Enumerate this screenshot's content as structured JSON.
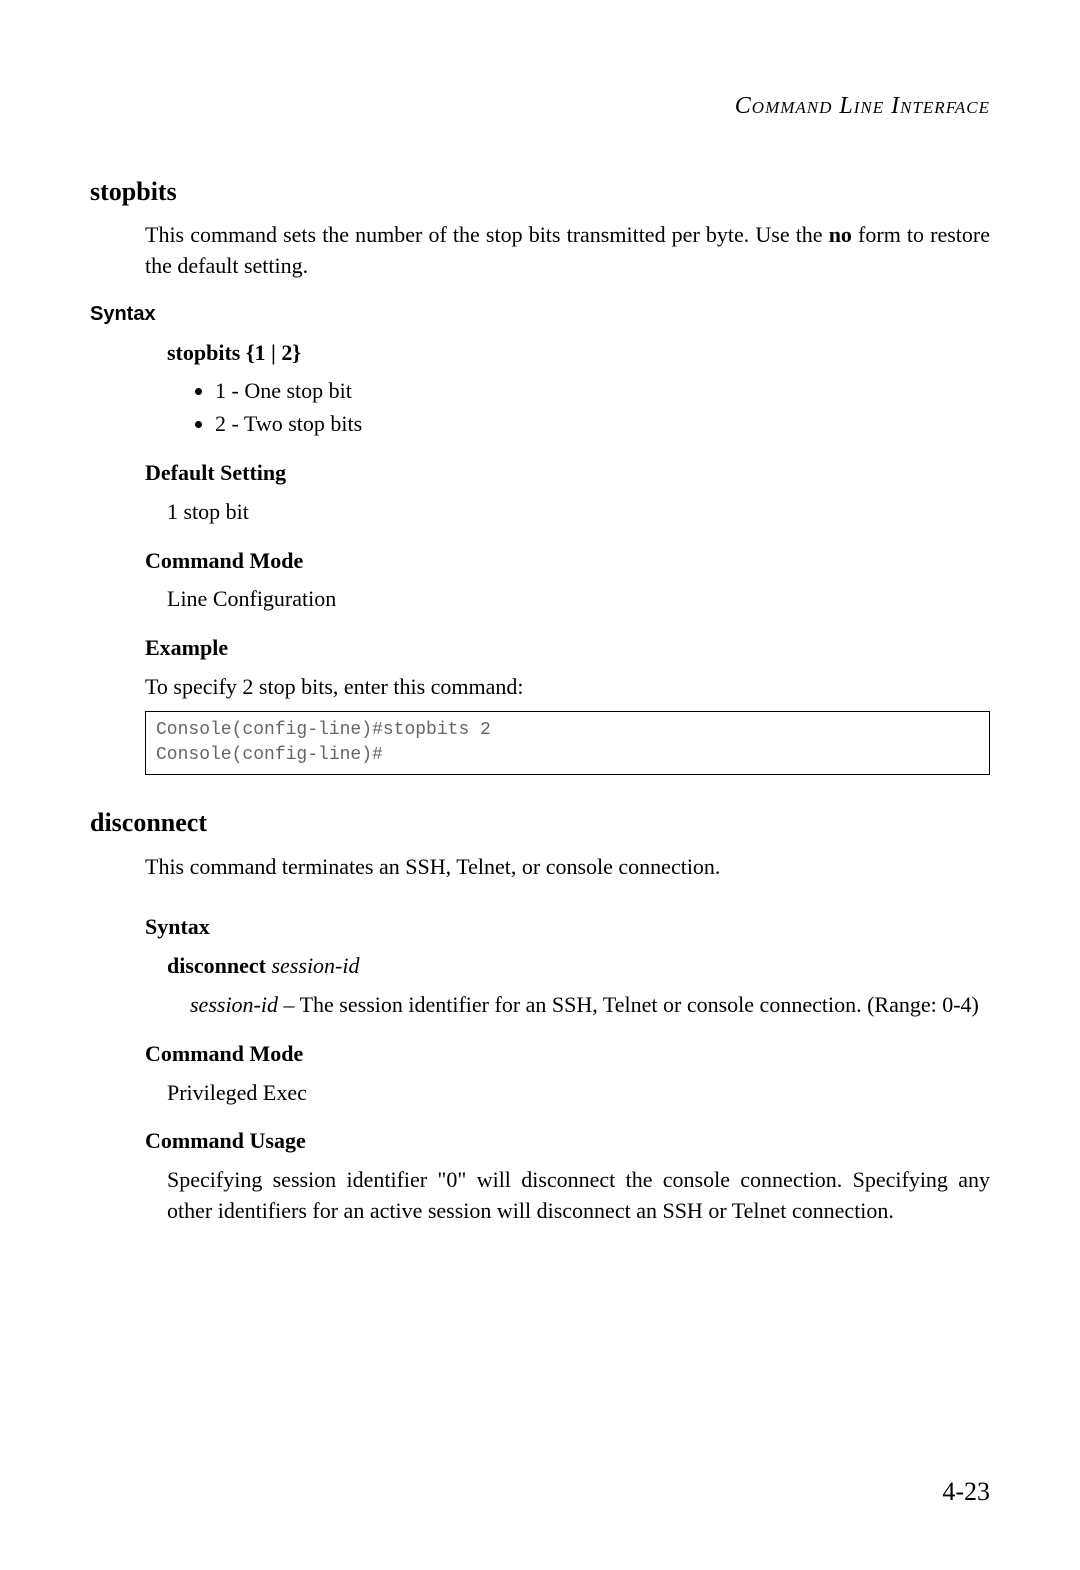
{
  "header": "Command Line Interface",
  "stopbits": {
    "title": "stopbits",
    "intro_pre": "This command sets the number of the stop bits transmitted per byte. Use the ",
    "intro_bold": "no",
    "intro_post": " form to restore the default setting.",
    "syntax_label": "Syntax",
    "syntax_cmd_bold": "stopbits",
    "syntax_cmd_rest": " {1 | 2}",
    "bullet1": "1 - One stop bit",
    "bullet2": "2 - Two stop bits",
    "default_label": "Default Setting",
    "default_value": "1 stop bit",
    "mode_label": "Command Mode",
    "mode_value": "Line Configuration",
    "example_label": "Example",
    "example_text": "To specify 2 stop bits, enter this command:",
    "code": "Console(config-line)#stopbits 2\nConsole(config-line)#"
  },
  "disconnect": {
    "title": "disconnect",
    "intro": "This command terminates an SSH, Telnet, or console connection.",
    "syntax_label": "Syntax",
    "syntax_cmd_bold": "disconnect",
    "syntax_cmd_ital": "session-id",
    "param_ital": "session-id",
    "param_rest": " – The session identifier for an SSH, Telnet or console connection. (Range: 0-4)",
    "mode_label": "Command Mode",
    "mode_value": "Privileged Exec",
    "usage_label": "Command Usage",
    "usage_text": "Specifying session identifier \"0\" will disconnect the console connection. Specifying any other identifiers for an active session will disconnect an SSH or Telnet connection."
  },
  "page_num": "4-23"
}
